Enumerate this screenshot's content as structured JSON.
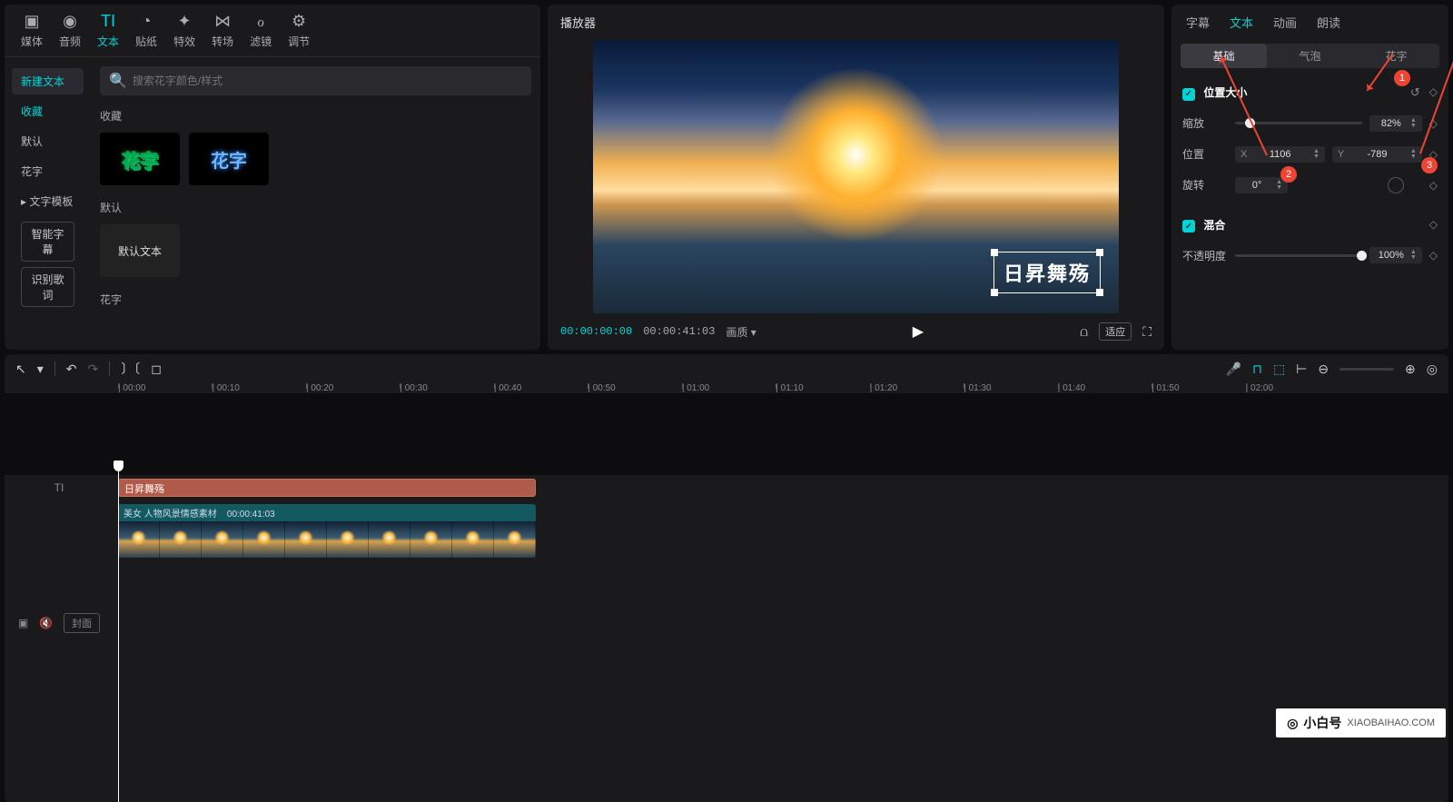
{
  "ribbon": [
    {
      "icon": "▣",
      "label": "媒体"
    },
    {
      "icon": "◉",
      "label": "音频"
    },
    {
      "icon": "TI",
      "label": "文本",
      "active": true
    },
    {
      "icon": "◔",
      "label": "贴纸"
    },
    {
      "icon": "✦",
      "label": "特效"
    },
    {
      "icon": "⋈",
      "label": "转场"
    },
    {
      "icon": "ℴ",
      "label": "滤镜"
    },
    {
      "icon": "⚙",
      "label": "调节"
    }
  ],
  "search": {
    "placeholder": "搜索花字颜色/样式"
  },
  "side": {
    "new_text": "新建文本",
    "fav": "收藏",
    "default": "默认",
    "huazi": "花字",
    "template": "文字模板",
    "smart": "智能字幕",
    "lyrics": "识别歌词"
  },
  "sections": {
    "fav": "收藏",
    "default": "默认",
    "default_text": "默认文本",
    "huazi": "花字",
    "huazi_sample": "花字"
  },
  "player": {
    "title": "播放器",
    "overlay_text": "日昇舞殇",
    "cur": "00:00:00:00",
    "dur": "00:00:41:03",
    "quality": "画质",
    "fit": "适应"
  },
  "props": {
    "tabs": [
      "字幕",
      "文本",
      "动画",
      "朗读"
    ],
    "active_tab": 1,
    "subtabs": [
      "基础",
      "气泡",
      "花字"
    ],
    "pos_size": "位置大小",
    "scale_label": "缩放",
    "scale_value": "82%",
    "pos_label": "位置",
    "pos_x_prefix": "X",
    "pos_x": "1106",
    "pos_y_prefix": "Y",
    "pos_y": "-789",
    "rot_label": "旋转",
    "rot_value": "0°",
    "mix": "混合",
    "opacity_label": "不透明度",
    "opacity_value": "100%"
  },
  "annotations": {
    "a1": "1",
    "a2": "2",
    "a3": "3"
  },
  "timeline": {
    "ticks": [
      "00:00",
      "00:10",
      "00:20",
      "00:30",
      "00:40",
      "00:50",
      "01:00",
      "01:10",
      "01:20",
      "01:30",
      "01:40",
      "01:50",
      "02:00"
    ],
    "text_clip": "日昇舞殇",
    "video_name": "美女 人物风景情感素材",
    "video_dur": "00:00:41:03",
    "cover": "封面"
  },
  "wm": {
    "brand": "小白号",
    "url": "XIAOBAIHAO.COM"
  }
}
